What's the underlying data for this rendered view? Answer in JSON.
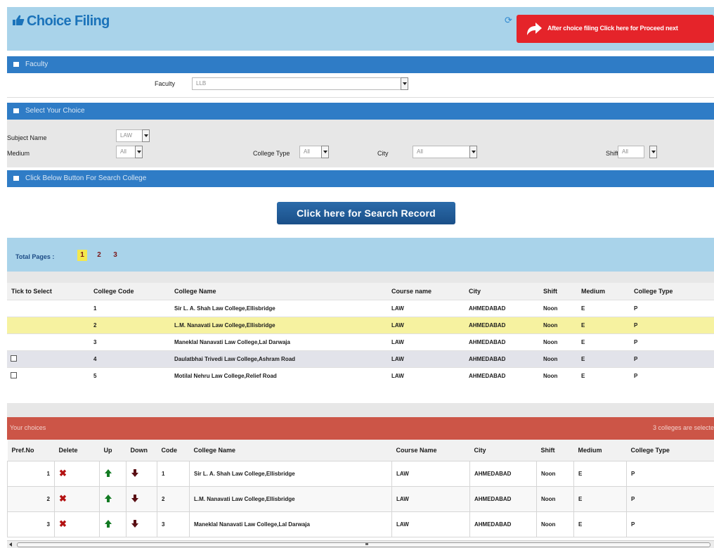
{
  "header": {
    "title": "Choice Filing",
    "proceed_label": "After choice filing Click here for Proceed next"
  },
  "faculty_section": {
    "title": "Faculty",
    "faculty_label": "Faculty",
    "faculty_value": "LLB"
  },
  "choice_section": {
    "title": "Select Your Choice",
    "subject_label": "Subject Name",
    "subject_value": "LAW",
    "medium_label": "Medium",
    "medium_value": "All",
    "college_type_label": "College Type",
    "college_type_value": "All",
    "city_label": "City",
    "city_value": "All",
    "shift_label": "Shift",
    "shift_value": "All"
  },
  "search_section": {
    "title": "Click Below Button For Search College",
    "button_label": "Click here for Search Record"
  },
  "pagination": {
    "label": "Total Pages :",
    "pages": [
      "1",
      "2",
      "3"
    ],
    "current": "1"
  },
  "college_table": {
    "headers": [
      "Tick to Select",
      "College Code",
      "College Name",
      "Course name",
      "City",
      "Shift",
      "Medium",
      "College Type"
    ],
    "rows": [
      {
        "checkbox": false,
        "code": "1",
        "name": "Sir L. A. Shah Law College,Ellisbridge",
        "course": "LAW",
        "city": "AHMEDABAD",
        "shift": "Noon",
        "medium": "E",
        "type": "P"
      },
      {
        "checkbox": false,
        "code": "2",
        "name": "L.M. Nanavati Law College,Ellisbridge",
        "course": "LAW",
        "city": "AHMEDABAD",
        "shift": "Noon",
        "medium": "E",
        "type": "P"
      },
      {
        "checkbox": false,
        "code": "3",
        "name": "Maneklal Nanavati Law College,Lal Darwaja",
        "course": "LAW",
        "city": "AHMEDABAD",
        "shift": "Noon",
        "medium": "E",
        "type": "P"
      },
      {
        "checkbox": true,
        "code": "4",
        "name": "Daulatbhai Trivedi Law College,Ashram Road",
        "course": "LAW",
        "city": "AHMEDABAD",
        "shift": "Noon",
        "medium": "E",
        "type": "P"
      },
      {
        "checkbox": true,
        "code": "5",
        "name": "Motilal Nehru Law College,Relief Road",
        "course": "LAW",
        "city": "AHMEDABAD",
        "shift": "Noon",
        "medium": "E",
        "type": "P"
      }
    ]
  },
  "choices": {
    "title": "Your choices",
    "count_text": "3 colleges are selecte",
    "headers": [
      "Pref.No",
      "Delete",
      "Up",
      "Down",
      "Code",
      "College Name",
      "Course Name",
      "City",
      "Shift",
      "Medium",
      "College Type"
    ],
    "rows": [
      {
        "pref": "1",
        "code": "1",
        "name": "Sir L. A. Shah Law College,Ellisbridge",
        "course": "LAW",
        "city": "AHMEDABAD",
        "shift": "Noon",
        "medium": "E",
        "type": "P"
      },
      {
        "pref": "2",
        "code": "2",
        "name": "L.M. Nanavati Law College,Ellisbridge",
        "course": "LAW",
        "city": "AHMEDABAD",
        "shift": "Noon",
        "medium": "E",
        "type": "P"
      },
      {
        "pref": "3",
        "code": "3",
        "name": "Maneklal Nanavati Law College,Lal Darwaja",
        "course": "LAW",
        "city": "AHMEDABAD",
        "shift": "Noon",
        "medium": "E",
        "type": "P"
      }
    ]
  },
  "colors": {
    "header_bg": "#a9d3ea",
    "section_bar": "#2f7cc6",
    "proceed_button": "#e5242a",
    "search_button": "#1f5c9a",
    "highlight_row": "#f6f2a0",
    "choices_bar": "#cc5547"
  },
  "icons": {
    "title_icon": "hand-pointer-icon",
    "proceed_icon": "share-arrow-icon",
    "section_icon": "list-icon",
    "delete_icon": "red-x-icon",
    "up_icon": "green-up-arrow-icon",
    "down_icon": "dark-down-arrow-icon"
  }
}
